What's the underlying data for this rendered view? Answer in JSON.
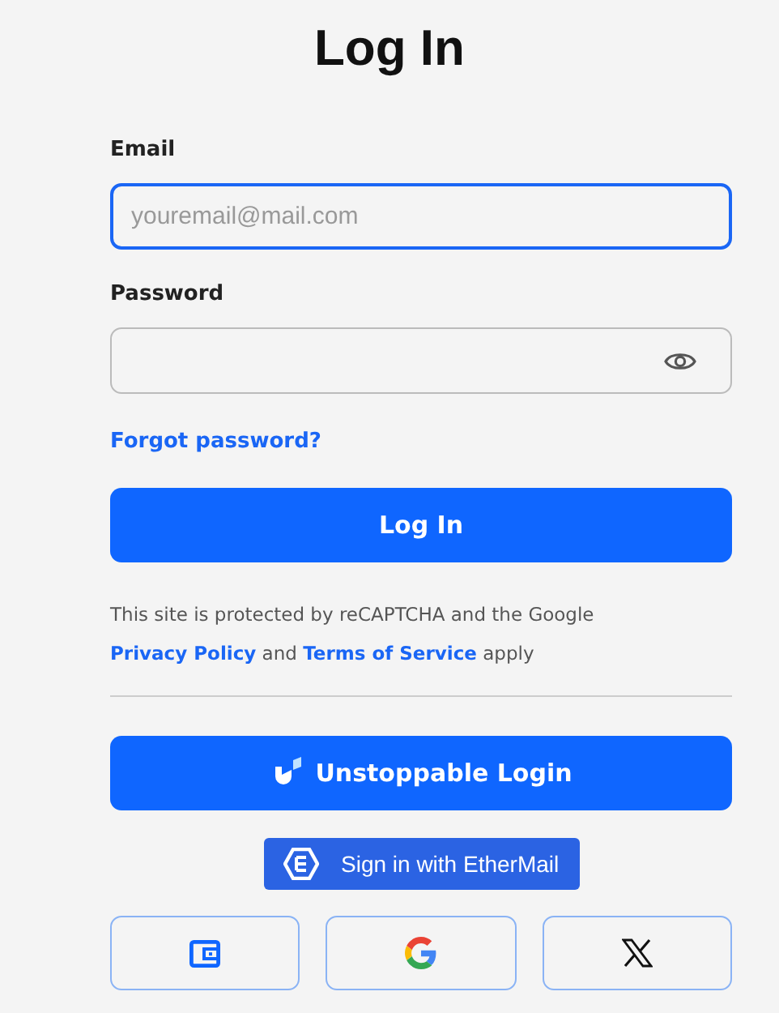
{
  "title": "Log In",
  "email": {
    "label": "Email",
    "placeholder": "youremail@mail.com",
    "focused": true
  },
  "password": {
    "label": "Password",
    "focused": false
  },
  "forgot_link": "Forgot password?",
  "login_button": "Log In",
  "recaptcha_note": [
    {
      "kind": "text",
      "text": "This site is protected by reCAPTCHA and the Google "
    },
    {
      "kind": "link",
      "text": "Privacy Policy"
    },
    {
      "kind": "text",
      "text": " and "
    },
    {
      "kind": "link",
      "text": "Terms of Service"
    },
    {
      "kind": "text",
      "text": " apply"
    }
  ],
  "unstoppable_button": "Unstoppable Login",
  "ethermail_button": "Sign in with EtherMail",
  "social_buttons": [
    {
      "kind": "wallet"
    },
    {
      "kind": "google"
    },
    {
      "kind": "x"
    }
  ]
}
